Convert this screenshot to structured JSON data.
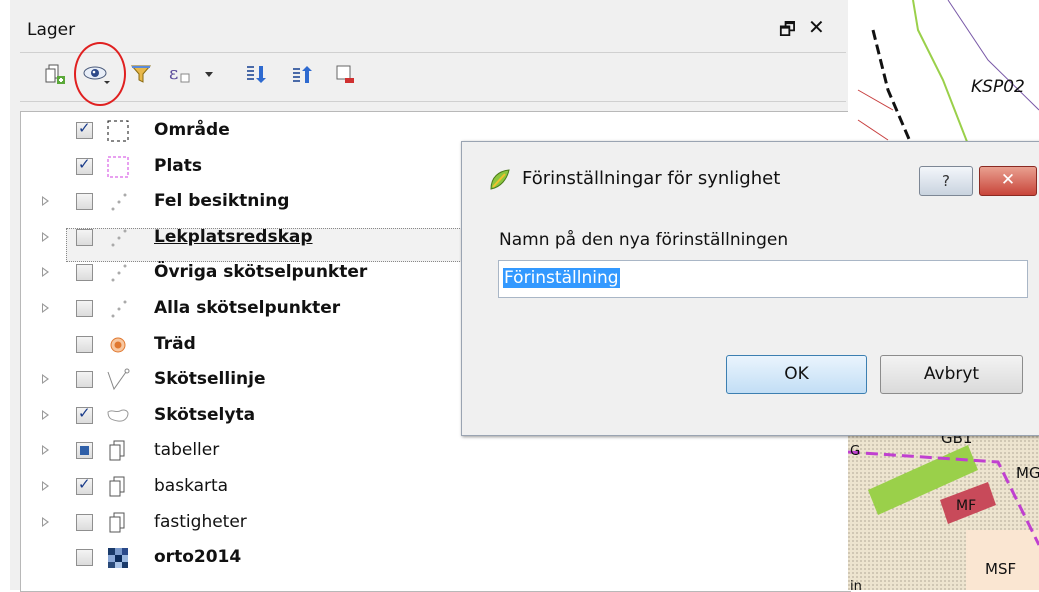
{
  "panel": {
    "title": "Lager",
    "float_icon": "restore-window-icon",
    "close_icon": "close-icon",
    "toolbar": [
      "add-group-icon",
      "visibility-presets-icon",
      "filter-icon",
      "filter-expression-icon",
      "expand-all-icon",
      "collapse-all-icon",
      "remove-layer-icon"
    ]
  },
  "layers": [
    {
      "name": "Område",
      "checked": true,
      "bold": true,
      "expander": false,
      "symbol": "dashed-black-square"
    },
    {
      "name": "Plats",
      "checked": true,
      "bold": true,
      "expander": false,
      "symbol": "dashed-magenta-square"
    },
    {
      "name": "Fel besiktning",
      "checked": false,
      "bold": true,
      "expander": true,
      "symbol": "points"
    },
    {
      "name": "Lekplatsredskap",
      "checked": false,
      "bold": true,
      "expander": true,
      "symbol": "points",
      "selected": true
    },
    {
      "name": "Övriga skötselpunkter",
      "checked": false,
      "bold": true,
      "expander": true,
      "symbol": "points"
    },
    {
      "name": "Alla skötselpunkter",
      "checked": false,
      "bold": true,
      "expander": true,
      "symbol": "points"
    },
    {
      "name": "Träd",
      "checked": false,
      "bold": true,
      "expander": false,
      "symbol": "orange-circle"
    },
    {
      "name": "Skötsellinje",
      "checked": false,
      "bold": true,
      "expander": true,
      "symbol": "line"
    },
    {
      "name": "Skötselyta",
      "checked": true,
      "bold": true,
      "expander": true,
      "symbol": "polygon"
    },
    {
      "name": "tabeller",
      "checked": "partial",
      "bold": false,
      "expander": true,
      "symbol": "group"
    },
    {
      "name": "baskarta",
      "checked": true,
      "bold": false,
      "expander": true,
      "symbol": "group"
    },
    {
      "name": "fastigheter",
      "checked": false,
      "bold": false,
      "expander": true,
      "symbol": "group"
    },
    {
      "name": "orto2014",
      "checked": false,
      "bold": true,
      "expander": false,
      "symbol": "raster"
    }
  ],
  "map": {
    "labels": [
      "KSP02",
      "GB1",
      "MG",
      "MF",
      "MSF",
      "G",
      "in"
    ]
  },
  "dialog": {
    "title": "Förinställningar för synlighet",
    "help": "?",
    "close": "✕",
    "label": "Namn på den nya förinställningen",
    "input_value": "Förinställning",
    "ok": "OK",
    "cancel": "Avbryt"
  },
  "colors": {
    "selection": "#3399ff",
    "annotation_circle": "#e02020"
  }
}
